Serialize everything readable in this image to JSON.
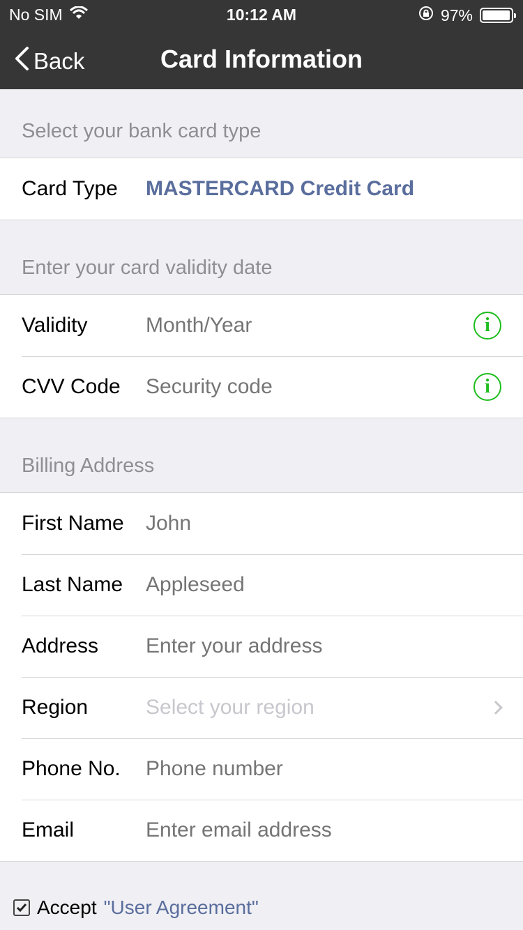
{
  "status_bar": {
    "carrier": "No SIM",
    "time": "10:12 AM",
    "battery": "97%",
    "battery_level": 0.97
  },
  "nav": {
    "back_label": "Back",
    "title": "Card Information"
  },
  "sections": {
    "card_type_header": "Select your bank card type",
    "validity_header": "Enter your card validity date",
    "billing_header": "Billing Address"
  },
  "card_type": {
    "label": "Card Type",
    "value": "MASTERCARD Credit Card"
  },
  "validity": {
    "label": "Validity",
    "placeholder": "Month/Year"
  },
  "cvv": {
    "label": "CVV Code",
    "placeholder": "Security code"
  },
  "billing": {
    "first_name": {
      "label": "First Name",
      "placeholder": "John"
    },
    "last_name": {
      "label": "Last Name",
      "placeholder": "Appleseed"
    },
    "address": {
      "label": "Address",
      "placeholder": "Enter your address"
    },
    "region": {
      "label": "Region",
      "placeholder": "Select your region"
    },
    "phone": {
      "label": "Phone No.",
      "placeholder": "Phone number"
    },
    "email": {
      "label": "Email",
      "placeholder": "Enter email address"
    }
  },
  "agreement": {
    "accept_label": "Accept",
    "link_label": "\"User Agreement\"",
    "checked": true
  },
  "colors": {
    "navbar": "#363636",
    "accent": "#5a6e9d",
    "info_icon": "#1ebd1e",
    "placeholder": "#c7c7cd",
    "background": "#efeff4"
  }
}
